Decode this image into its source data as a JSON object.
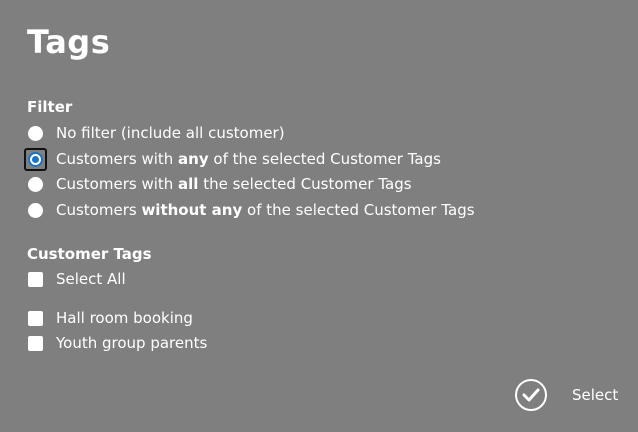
{
  "title": "Tags",
  "filter": {
    "label": "Filter",
    "options": [
      {
        "parts": [
          {
            "text": "No filter (include all customer)",
            "bold": false
          }
        ],
        "selected": false
      },
      {
        "parts": [
          {
            "text": "Customers with ",
            "bold": false
          },
          {
            "text": "any",
            "bold": true
          },
          {
            "text": " of the selected Customer Tags",
            "bold": false
          }
        ],
        "selected": true
      },
      {
        "parts": [
          {
            "text": "Customers with ",
            "bold": false
          },
          {
            "text": "all",
            "bold": true
          },
          {
            "text": " the selected Customer Tags",
            "bold": false
          }
        ],
        "selected": false
      },
      {
        "parts": [
          {
            "text": "Customers ",
            "bold": false
          },
          {
            "text": "without any",
            "bold": true
          },
          {
            "text": " of the selected Customer Tags",
            "bold": false
          }
        ],
        "selected": false
      }
    ]
  },
  "customer_tags": {
    "label": "Customer Tags",
    "select_all_label": "Select All",
    "items": [
      {
        "label": "Hall room booking",
        "checked": false
      },
      {
        "label": "Youth group parents",
        "checked": false
      }
    ]
  },
  "actions": {
    "select_label": "Select",
    "select_icon": "check-circle-icon"
  },
  "colors": {
    "background": "#7f7f7f",
    "radio_accent": "#1a73c8",
    "text": "#ffffff"
  }
}
